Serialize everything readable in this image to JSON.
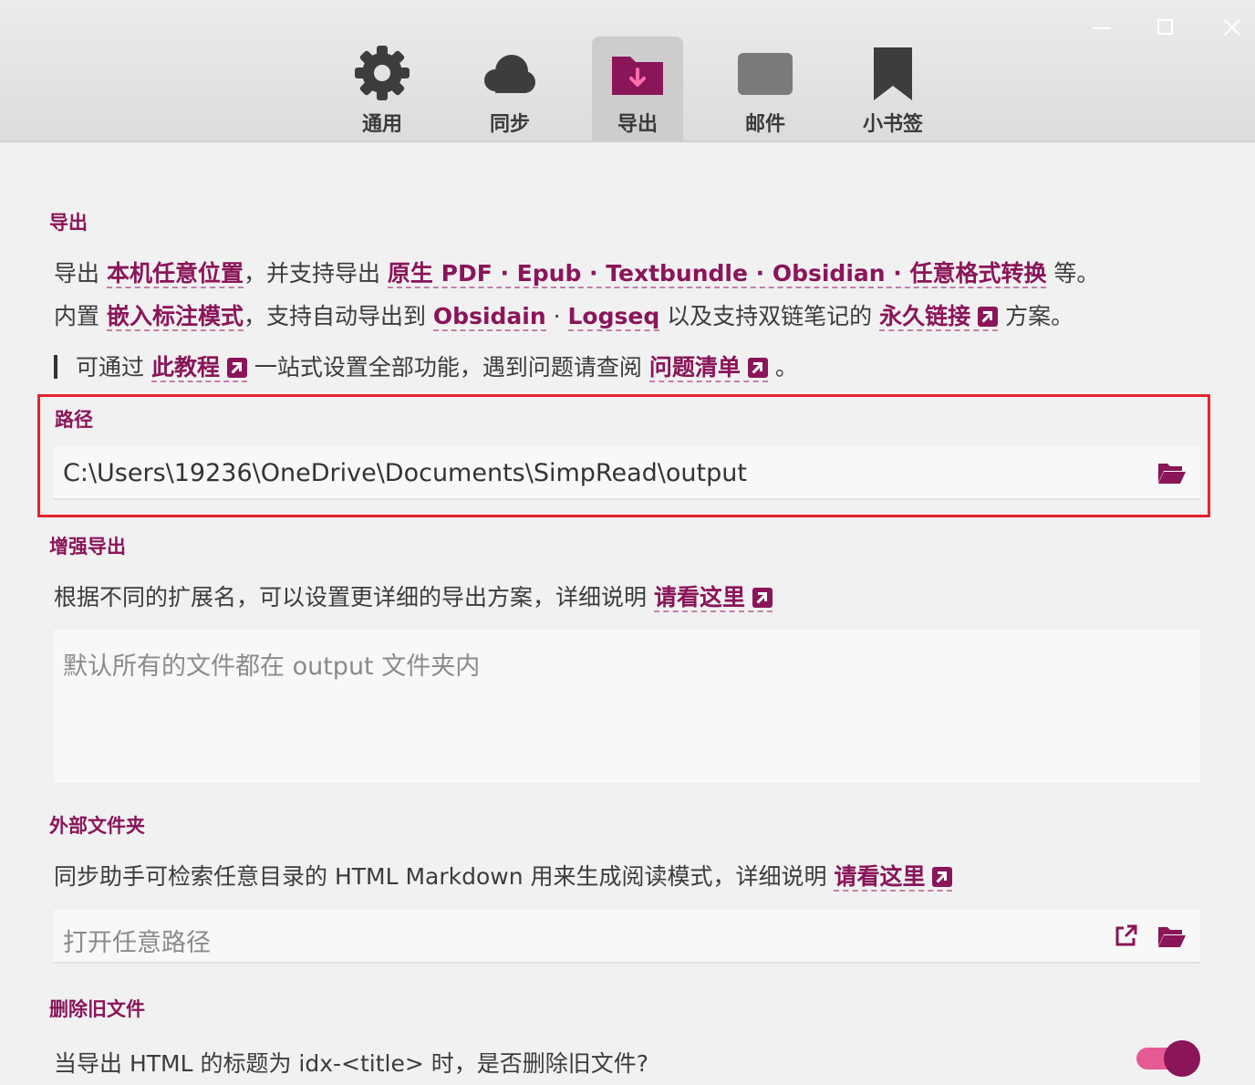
{
  "tabs": [
    {
      "label": "通用",
      "icon": "gear-icon"
    },
    {
      "label": "同步",
      "icon": "cloud-icon"
    },
    {
      "label": "导出",
      "icon": "folder-download-icon"
    },
    {
      "label": "邮件",
      "icon": "mail-icon"
    },
    {
      "label": "小书签",
      "icon": "bookmark-icon"
    }
  ],
  "active_tab": "导出",
  "accent_color": "#8a1559",
  "export": {
    "title": "导出",
    "line1": {
      "t1": "导出 ",
      "l1": "本机任意位置",
      "t2": "，并支持导出 ",
      "l2": "原生 PDF · Epub · Textbundle · Obsidian · 任意格式转换",
      "t3": " 等。"
    },
    "line2": {
      "t1": "内置 ",
      "l1": "嵌入标注模式",
      "t2": "，支持自动导出到 ",
      "l2": "Obsidain",
      "t3": " · ",
      "l3": "Logseq",
      "t4": " 以及支持双链笔记的 ",
      "l4": "永久链接",
      "t5": " 方案。"
    },
    "line3": {
      "t1": "可通过 ",
      "l1": "此教程",
      "t2": " 一站式设置全部功能，遇到问题请查阅 ",
      "l2": "问题清单",
      "t3": " 。"
    }
  },
  "path": {
    "title": "路径",
    "value": "C:\\Users\\19236\\OneDrive\\Documents\\SimpRead\\output"
  },
  "enhanced": {
    "title": "增强导出",
    "desc": "根据不同的扩展名，可以设置更详细的导出方案，详细说明 ",
    "link": "请看这里",
    "placeholder": "默认所有的文件都在 output 文件夹内"
  },
  "external": {
    "title": "外部文件夹",
    "desc": "同步助手可检索任意目录的 HTML Markdown 用来生成阅读模式，详细说明 ",
    "link": "请看这里",
    "placeholder": "打开任意路径"
  },
  "delete_old": {
    "title": "删除旧文件",
    "desc": "当导出 HTML 的标题为 idx-<title> 时，是否删除旧文件?",
    "enabled": true
  }
}
